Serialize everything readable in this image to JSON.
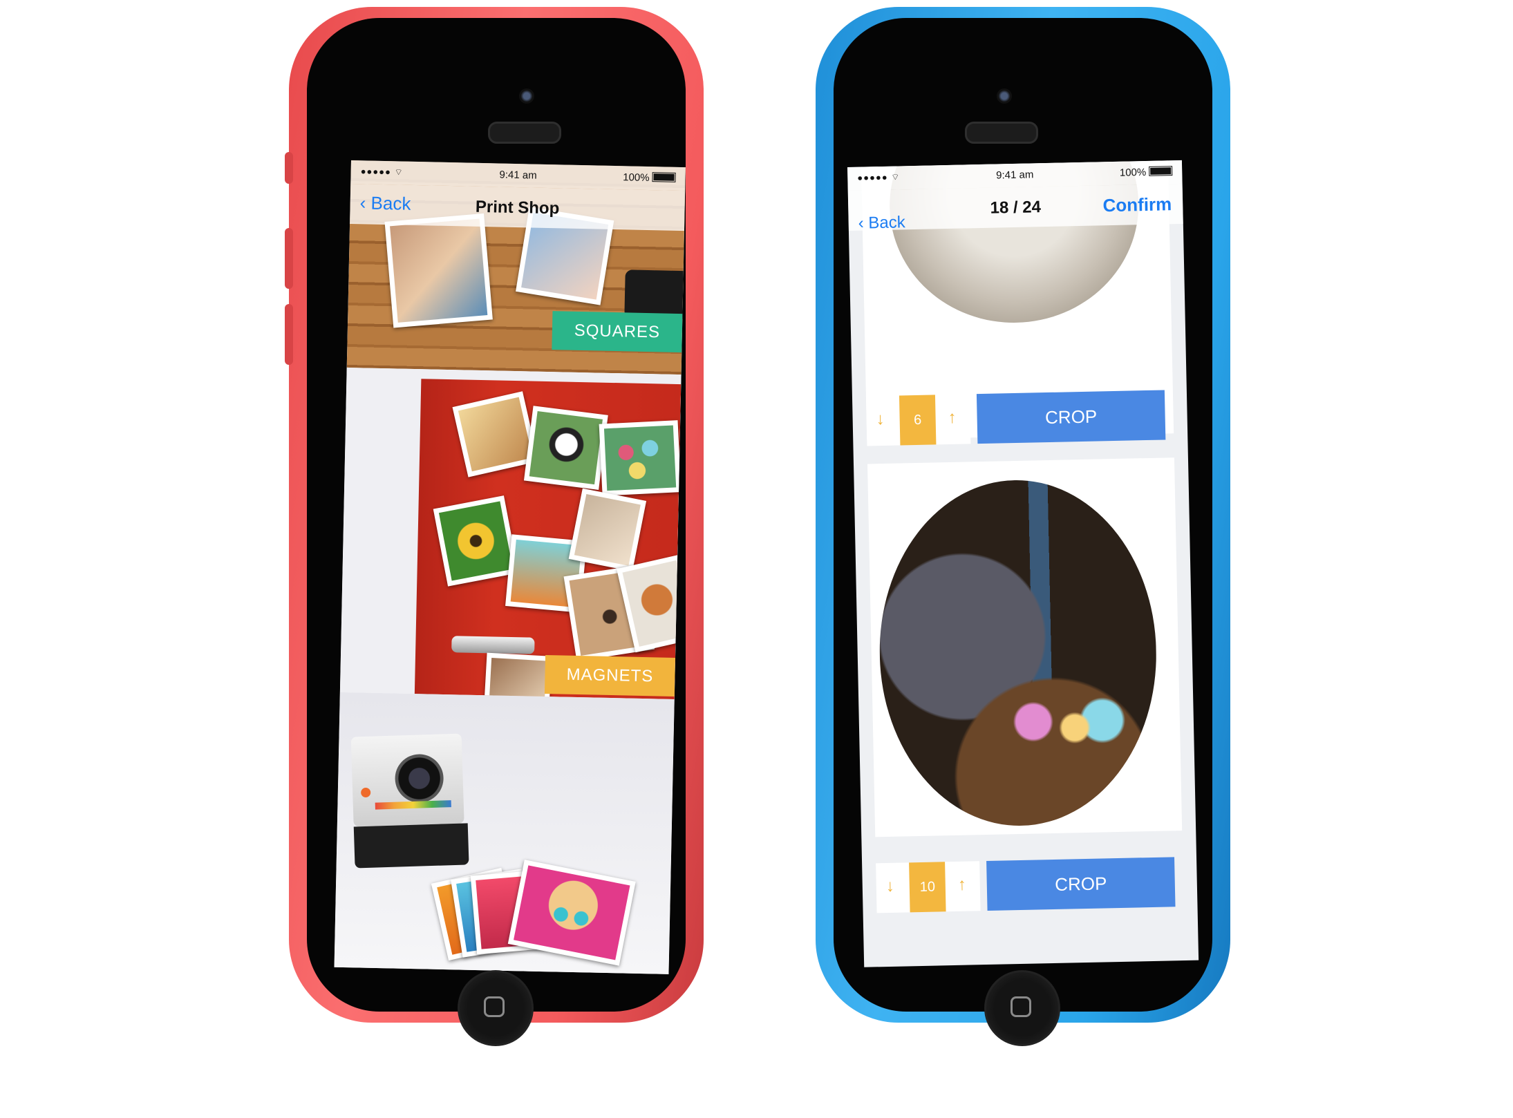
{
  "left_phone": {
    "status": {
      "signal": "●●●●● ⌔",
      "time": "9:41 am",
      "battery": "100%"
    },
    "nav": {
      "back_label": "Back",
      "title": "Print Shop"
    },
    "products": [
      {
        "label": "SQUARES",
        "color": "#2bb58a"
      },
      {
        "label": "MAGNETS",
        "color": "#f2b43c"
      }
    ]
  },
  "right_phone": {
    "status": {
      "signal": "●●●●● ⌔",
      "time": "9:41 am",
      "battery": "100%"
    },
    "nav": {
      "back_label": "Back",
      "title": "18 / 24",
      "action_label": "Confirm"
    },
    "crop_items": [
      {
        "count": "6",
        "crop_label": "CROP",
        "decrease_icon": "↓",
        "increase_icon": "↑"
      },
      {
        "count": "10",
        "crop_label": "CROP",
        "decrease_icon": "↓",
        "increase_icon": "↑"
      }
    ]
  },
  "colors": {
    "ios_blue": "#1b7cf2",
    "crop_button": "#4a88e3",
    "counter_accent": "#f3b73f",
    "phone_left": "#f45b5d",
    "phone_right": "#2aa5ea"
  }
}
